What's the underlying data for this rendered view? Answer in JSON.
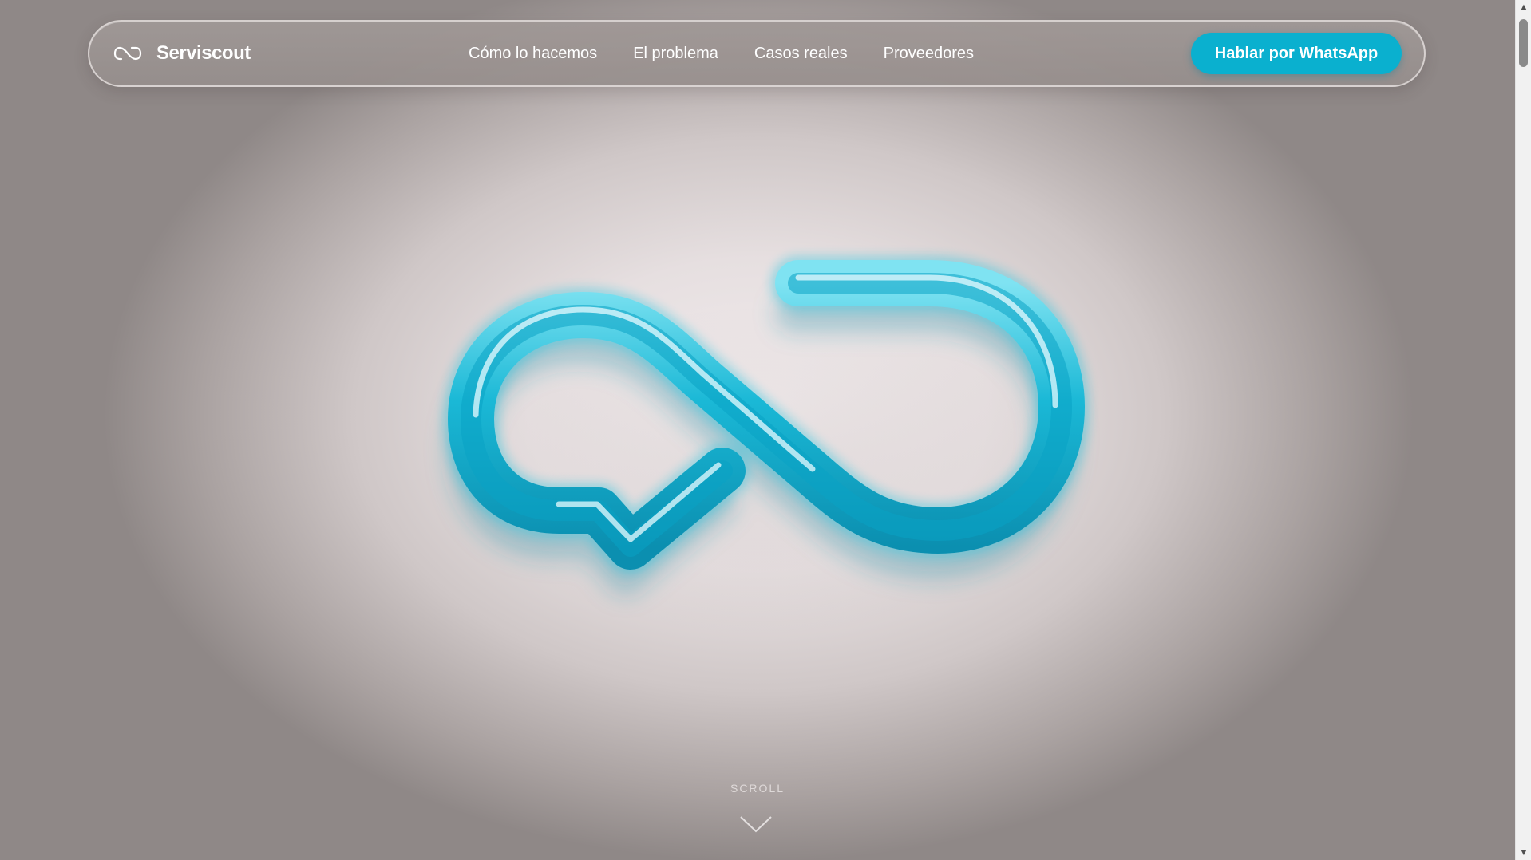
{
  "brand": {
    "name": "Serviscout",
    "icon": "infinity-icon"
  },
  "nav": {
    "links": [
      {
        "label": "Cómo lo hacemos"
      },
      {
        "label": "El problema"
      },
      {
        "label": "Casos reales"
      },
      {
        "label": "Proveedores"
      }
    ],
    "cta_label": "Hablar por WhatsApp"
  },
  "hero": {
    "scroll_label": "SCROLL",
    "scroll_icon": "chevron-down-icon",
    "logo_icon": "infinity-chat-check-logo"
  },
  "colors": {
    "accent": "#0ab0cf",
    "logo_glass": "#1ab8d6",
    "navbar_bg": "#9c9492"
  }
}
